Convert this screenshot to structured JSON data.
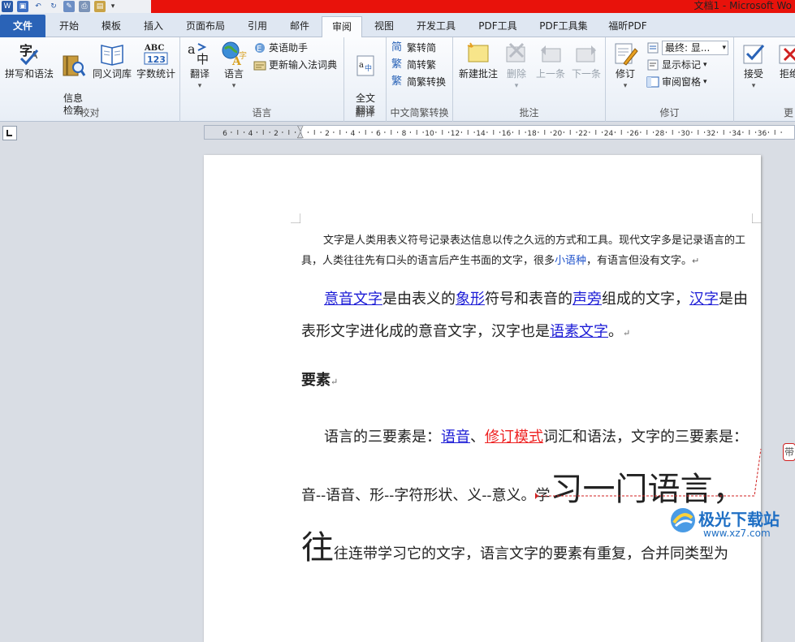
{
  "window": {
    "title": "文档1 - Microsoft Wo"
  },
  "qat": {
    "icons": [
      "word-app-icon",
      "save-icon",
      "undo-icon",
      "redo-icon",
      "print-preview-icon",
      "quick-print-icon",
      "new-doc-icon",
      "customize-qat-icon"
    ]
  },
  "tabs": {
    "file": "文件",
    "items": [
      "开始",
      "模板",
      "插入",
      "页面布局",
      "引用",
      "邮件",
      "审阅",
      "视图",
      "开发工具",
      "PDF工具",
      "PDF工具集",
      "福昕PDF"
    ],
    "active": "审阅"
  },
  "ribbon": {
    "proofing": {
      "label": "校对",
      "spelling": "拼写和语法",
      "research": "信息\n检索",
      "thesaurus": "同义词库",
      "wordcount": "字数统计"
    },
    "language": {
      "label": "语言",
      "translate": "翻译",
      "language": "语言",
      "english_assistant": "英语助手",
      "update_ime": "更新输入法词典"
    },
    "translate": {
      "label": "翻译",
      "full_translate": "全文\n翻译"
    },
    "chinese": {
      "label": "中文简繁转换",
      "to_simplified": "繁转简",
      "to_traditional": "简转繁",
      "convert": "简繁转换"
    },
    "comments": {
      "label": "批注",
      "new": "新建批注",
      "delete": "删除",
      "prev": "上一条",
      "next": "下一条"
    },
    "tracking": {
      "label": "修订",
      "track": "修订",
      "final": "最终: 显...",
      "show_markup": "显示标记",
      "reviewing_pane": "审阅窗格"
    },
    "changes": {
      "accept": "接受",
      "reject": "拒绝",
      "label": "更"
    }
  },
  "ruler": {
    "ticks": [
      "6",
      "4",
      "2",
      "",
      "2",
      "4",
      "6",
      "8",
      "10",
      "12",
      "14",
      "16",
      "18",
      "20",
      "22",
      "24",
      "26",
      "28",
      "30",
      "32",
      "34",
      "36"
    ]
  },
  "document": {
    "para1": "文字是人类用表义符号记录表达信息以传之久远的方式和工具。现代文字多是记录语言的工具，人类往往先有口头的语言后产生书面的文字，很多",
    "para1_link": "小语种",
    "para1_end": "，有语言但没有文字。",
    "para2_l1": "意音文字",
    "para2_t1": "是由表义的",
    "para2_l2": "象形",
    "para2_t2": "符号和表音的",
    "para2_l3": "声旁",
    "para2_t3": "组成的文字，",
    "para2_l4": "汉字",
    "para2_t4": "是由表形文字进化成的意音文字，汉字也是",
    "para2_l5": "语素文字",
    "para2_t5": "。",
    "heading": "要素",
    "para4_t1": "语言的三要素是：",
    "para4_l1": "语音",
    "para4_sep": "、",
    "para4_rev": "修订模式",
    "para4_t2": "词汇和语法，文字的三要素是：音--语音、形--字符形状、义--意义。学",
    "para4_huge1": "习一门语言，往",
    "para4_t3": "往连带学习它的文字，语言文字的要素有重复，合并同类型为",
    "para_mark": "↵",
    "comment_tag": "带"
  },
  "watermark": {
    "text": "极光下载站",
    "url": "www.xz7.com"
  }
}
